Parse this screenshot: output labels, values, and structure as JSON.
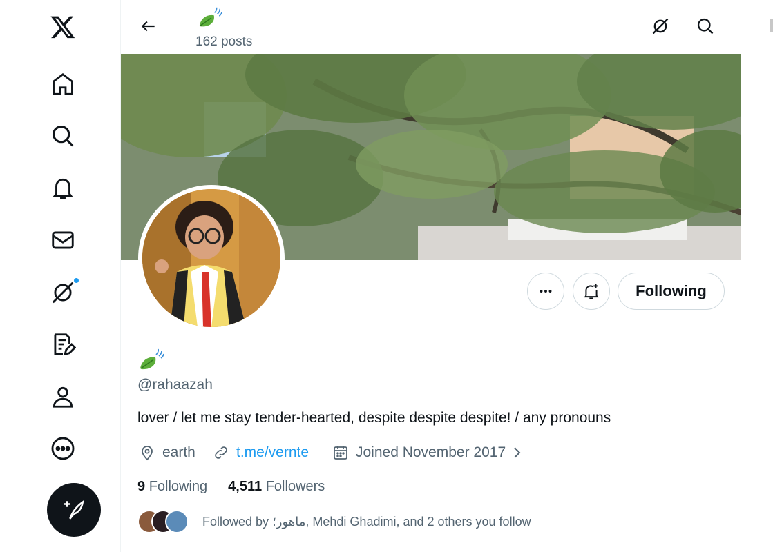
{
  "nav": {
    "items": [
      {
        "name": "x-logo",
        "interactable": true
      },
      {
        "name": "home"
      },
      {
        "name": "explore"
      },
      {
        "name": "notifications"
      },
      {
        "name": "messages"
      },
      {
        "name": "grok"
      },
      {
        "name": "lists"
      },
      {
        "name": "profile"
      },
      {
        "name": "more"
      }
    ],
    "unread_dot_color": "#1d9bf0"
  },
  "header": {
    "display_name_emoji": "🍃",
    "post_count": "162 posts"
  },
  "profile": {
    "display_name_emoji": "🍃",
    "handle": "@rahaazah",
    "bio": "lover / let me stay tender-hearted, despite despite despite! / any pronouns",
    "location": "earth",
    "website": "t.me/vernte",
    "joined": "Joined November 2017",
    "following_count": "9",
    "following_label": "Following",
    "followers_count": "4,511",
    "followers_label": "Followers",
    "followed_by": "Followed by ماهور؛, Mehdi Ghadimi, and 2 others you follow"
  },
  "actions": {
    "following_button": "Following"
  },
  "colors": {
    "accent": "#1d9bf0",
    "text_primary": "#0f1419",
    "text_secondary": "#536471"
  }
}
